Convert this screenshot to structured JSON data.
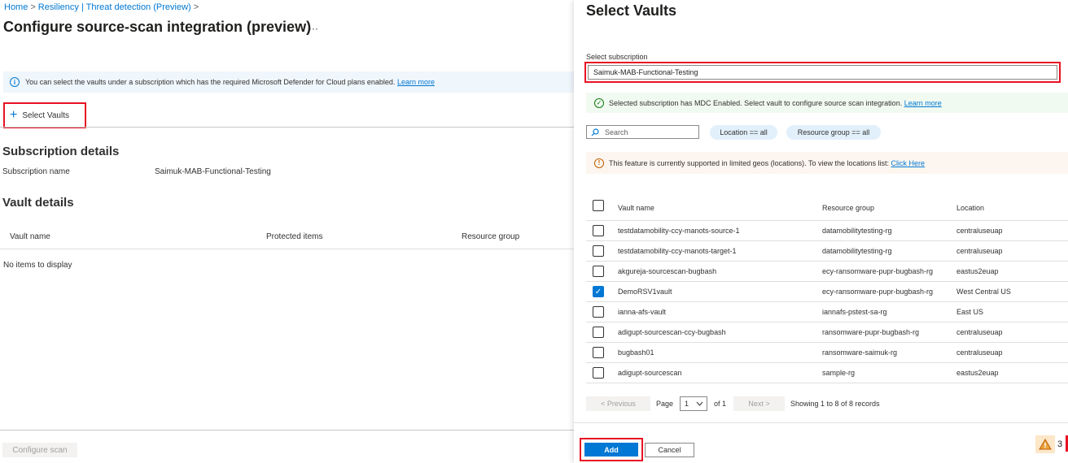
{
  "breadcrumb": {
    "items": [
      "Home",
      "Resiliency | Threat detection (Preview)"
    ],
    "separator": ">"
  },
  "page": {
    "title": "Configure source-scan integration (preview)",
    "more_label": "···",
    "info_text": "You can select the vaults under a subscription which has the required Microsoft Defender for Cloud plans enabled.",
    "info_link": "Learn more",
    "select_vaults_label": "Select Vaults",
    "subscription_section": "Subscription details",
    "subscription_name_label": "Subscription name",
    "subscription_name_value": "Saimuk-MAB-Functional-Testing",
    "vault_section": "Vault details",
    "grid_columns": [
      "Vault name",
      "Protected items",
      "Resource group"
    ],
    "empty_text": "No items to display",
    "configure_scan_label": "Configure scan"
  },
  "blade": {
    "title": "Select Vaults",
    "subscription_label": "Select subscription",
    "subscription_value": "Saimuk-MAB-Functional-Testing",
    "success_text": "Selected subscription has MDC Enabled. Select vault to configure source scan integration.",
    "success_link": "Learn more",
    "search_placeholder": "Search",
    "filters": [
      "Location == all",
      "Resource group == all"
    ],
    "warning_text": "This feature is currently supported in limited geos (locations). To view the locations list:",
    "warning_link": "Click Here",
    "table": {
      "columns": [
        "Vault name",
        "Resource group",
        "Location"
      ],
      "rows": [
        {
          "name": "testdatamobility-ccy-manots-source-1",
          "resource_group": "datamobilitytesting-rg",
          "location": "centraluseuap",
          "checked": false
        },
        {
          "name": "testdatamobility-ccy-manots-target-1",
          "resource_group": "datamobilitytesting-rg",
          "location": "centraluseuap",
          "checked": false
        },
        {
          "name": "akgureja-sourcescan-bugbash",
          "resource_group": "ecy-ransomware-pupr-bugbash-rg",
          "location": "eastus2euap",
          "checked": false
        },
        {
          "name": "DemoRSV1vault",
          "resource_group": "ecy-ransomware-pupr-bugbash-rg",
          "location": "West Central US",
          "checked": true
        },
        {
          "name": "ianna-afs-vault",
          "resource_group": "iannafs-pstest-sa-rg",
          "location": "East US",
          "checked": false
        },
        {
          "name": "adigupt-sourcescan-ccy-bugbash",
          "resource_group": "ransomware-pupr-bugbash-rg",
          "location": "centraluseuap",
          "checked": false
        },
        {
          "name": "bugbash01",
          "resource_group": "ransomware-saimuk-rg",
          "location": "centraluseuap",
          "checked": false
        },
        {
          "name": "adigupt-sourcescan",
          "resource_group": "sample-rg",
          "location": "eastus2euap",
          "checked": false
        }
      ]
    },
    "pager": {
      "previous_label": "< Previous",
      "page_label": "Page",
      "page_value": "1",
      "of_label": "of 1",
      "next_label": "Next >",
      "summary": "Showing 1 to 8 of 8 records"
    },
    "add_label": "Add",
    "cancel_label": "Cancel",
    "notification_count": "3"
  },
  "colors": {
    "accent": "#0078d4",
    "highlight": "#e81123",
    "success": "#107c10",
    "warning": "#c25e00"
  },
  "icons": [
    "info-icon",
    "plus-icon",
    "check-circle-icon",
    "search-icon",
    "warning-icon",
    "chevron-down-icon",
    "warning-triangle-icon"
  ]
}
